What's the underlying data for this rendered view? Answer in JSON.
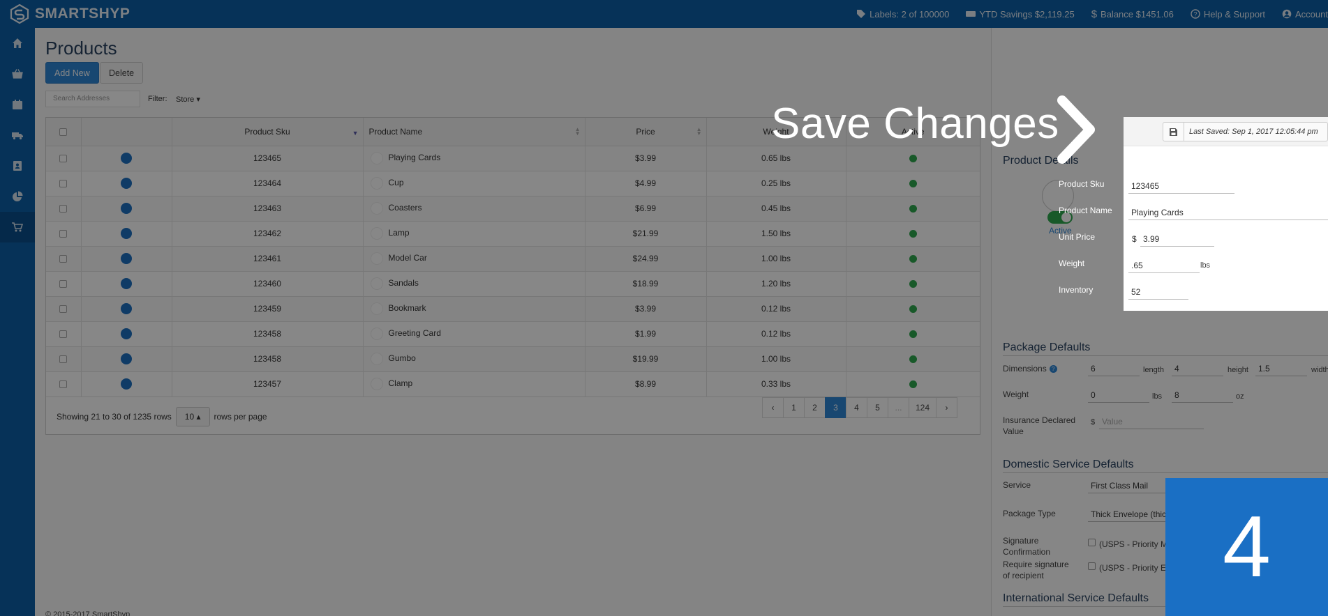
{
  "app": {
    "name": "SMARTSHYP"
  },
  "topbar": {
    "labels": "Labels: 2 of 100000",
    "ytd_savings": "YTD Savings $2,119.25",
    "balance": "Balance $1451.06",
    "help": "Help & Support",
    "account": "Account"
  },
  "sidebar": {
    "items": [
      {
        "icon": "home-icon"
      },
      {
        "icon": "basket-icon"
      },
      {
        "icon": "calendar-icon"
      },
      {
        "icon": "truck-icon"
      },
      {
        "icon": "address-book-icon"
      },
      {
        "icon": "pie-chart-icon"
      },
      {
        "icon": "cart-icon",
        "active": true
      }
    ]
  },
  "page": {
    "title": "Products",
    "add_new": "Add New",
    "delete": "Delete",
    "search_placeholder": "Search Addresses",
    "filter_label": "Filter:",
    "filter_value": "Store ▾"
  },
  "table": {
    "columns": [
      "Product Sku",
      "Product Name",
      "Price",
      "Weight",
      "Active"
    ],
    "rows": [
      {
        "sku": "123465",
        "name": "Playing Cards",
        "price": "$3.99",
        "weight": "0.65 lbs"
      },
      {
        "sku": "123464",
        "name": "Cup",
        "price": "$4.99",
        "weight": "0.25 lbs"
      },
      {
        "sku": "123463",
        "name": "Coasters",
        "price": "$6.99",
        "weight": "0.45 lbs"
      },
      {
        "sku": "123462",
        "name": "Lamp",
        "price": "$21.99",
        "weight": "1.50 lbs"
      },
      {
        "sku": "123461",
        "name": "Model Car",
        "price": "$24.99",
        "weight": "1.00 lbs"
      },
      {
        "sku": "123460",
        "name": "Sandals",
        "price": "$18.99",
        "weight": "1.20 lbs"
      },
      {
        "sku": "123459",
        "name": "Bookmark",
        "price": "$3.99",
        "weight": "0.12 lbs"
      },
      {
        "sku": "123458",
        "name": "Greeting Card",
        "price": "$1.99",
        "weight": "0.12 lbs"
      },
      {
        "sku": "123458",
        "name": "Gumbo",
        "price": "$19.99",
        "weight": "1.00 lbs"
      },
      {
        "sku": "123457",
        "name": "Clamp",
        "price": "$8.99",
        "weight": "0.33 lbs"
      }
    ],
    "showing": "Showing 21 to 30 of 1235 rows",
    "rows_per_page_value": "10 ▴",
    "rows_per_page_label": "rows per page",
    "pages": [
      "‹",
      "1",
      "2",
      "3",
      "4",
      "5",
      "...",
      "124",
      "›"
    ],
    "active_page": "3"
  },
  "footer": {
    "copyright": "© 2015-2017 SmartShyp"
  },
  "panel": {
    "last_saved": "Last Saved: Sep 1, 2017 12:05:44 pm",
    "product_details_title": "Product Details",
    "active_label": "Active",
    "fields": {
      "sku_label": "Product Sku",
      "sku": "123465",
      "name_label": "Product Name",
      "name": "Playing Cards",
      "price_label": "Unit Price",
      "price_symbol": "$",
      "price": "3.99",
      "weight_label": "Weight",
      "weight": ".65",
      "weight_unit": "lbs",
      "inventory_label": "Inventory",
      "inventory": "52"
    },
    "package": {
      "title": "Package Defaults",
      "dimensions_label": "Dimensions",
      "length": "6",
      "length_unit": "length",
      "height": "4",
      "height_unit": "height",
      "width": "1.5",
      "width_unit": "width",
      "weight_label": "Weight",
      "lbs": "0",
      "lbs_unit": "lbs",
      "oz": "8",
      "oz_unit": "oz",
      "insurance_label": "Insurance Declared Value",
      "insurance_symbol": "$",
      "insurance_placeholder": "Value"
    },
    "domestic": {
      "title": "Domestic Service Defaults",
      "service_label": "Service",
      "service": "First Class Mail",
      "package_type_label": "Package Type",
      "package_type": "Thick Envelope (thic",
      "signature_label": "Signature Confirmation",
      "signature_text": "(USPS - Priority M",
      "require_label": "Require signature of recipient",
      "require_text": "(USPS - Priority E"
    },
    "international": {
      "title": "International Service Defaults"
    }
  },
  "overlay": {
    "callout": "Save Changes",
    "step": "4"
  },
  "colors": {
    "brand": "#0d5fa6",
    "accent": "#2f86d6",
    "step": "#1a6fc4",
    "active": "#2fa84f"
  }
}
